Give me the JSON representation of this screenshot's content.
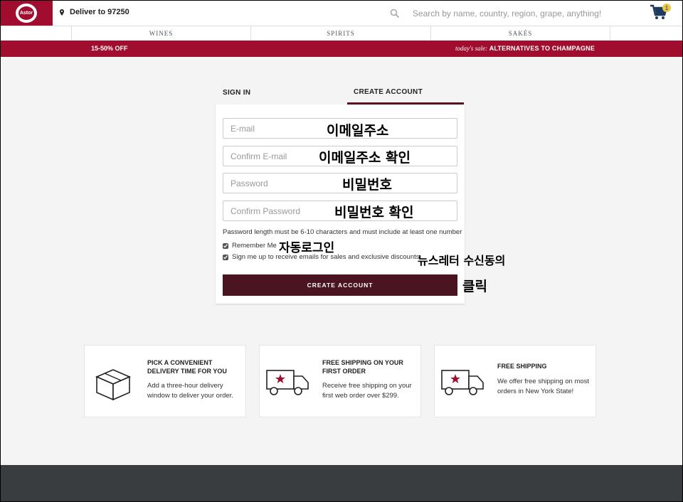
{
  "header": {
    "logo_text": "Astor",
    "deliver_label": "Deliver to 97250",
    "search_placeholder": "Search by name, country, region, grape, anything!",
    "cart_count": "1"
  },
  "nav": {
    "items": [
      "WINES",
      "SPIRITS",
      "SAKÉS"
    ]
  },
  "promo": {
    "left": "15-50% OFF",
    "right_prefix": "today's sale:",
    "right_text": "ALTERNATIVES TO CHAMPAGNE"
  },
  "tabs": {
    "sign_in": "SIGN IN",
    "create_account": "CREATE ACCOUNT"
  },
  "form": {
    "email_placeholder": "E-mail",
    "confirm_email_placeholder": "Confirm E-mail",
    "password_placeholder": "Password",
    "confirm_password_placeholder": "Confirm Password",
    "password_note": "Password length must be 6-10 characters and must include at least one number",
    "remember_me": "Remember Me",
    "newsletter": "Sign me up to receive emails for sales and exclusive discounts.",
    "submit_label": "CREATE ACCOUNT"
  },
  "annotations": {
    "email": "이메일주소",
    "confirm_email": "이메일주소 확인",
    "password": "비밀번호",
    "confirm_password": "비밀번호 확인",
    "remember": "자동로그인",
    "newsletter": "뉴스레터 수신동의",
    "click": "클릭"
  },
  "features": [
    {
      "title": "PICK A CONVENIENT DELIVERY TIME FOR YOU",
      "desc": "Add a three-hour delivery window to deliver your order.",
      "icon": "box-icon"
    },
    {
      "title": "FREE SHIPPING ON YOUR FIRST ORDER",
      "desc": "Receive free shipping on your first web order over $299.",
      "icon": "truck-icon"
    },
    {
      "title": "FREE SHIPPING",
      "desc": "We offer free shipping on most orders in New York State!",
      "icon": "truck-icon"
    }
  ],
  "colors": {
    "brand": "#a10d2e",
    "button": "#4a1520",
    "footer": "#3a3d40"
  }
}
